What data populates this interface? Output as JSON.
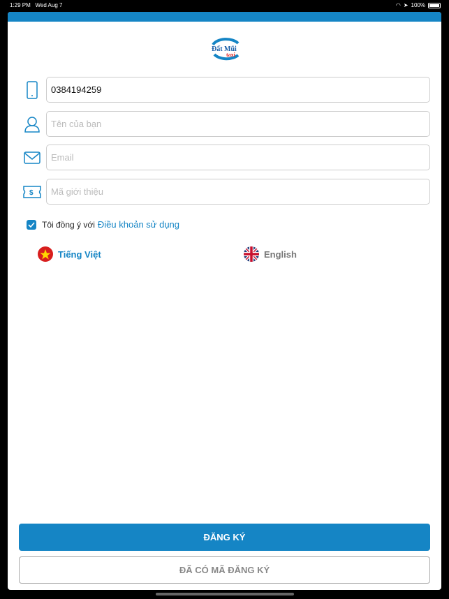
{
  "status_bar": {
    "time": "1:29 PM",
    "date": "Wed Aug 7",
    "battery": "100%"
  },
  "logo": {
    "text_main": "Đất Mũi",
    "text_sub": "taxi"
  },
  "form": {
    "phone": {
      "value": "0384194259",
      "icon": "phone-icon"
    },
    "name": {
      "placeholder": "Tên của bạn",
      "icon": "user-icon"
    },
    "email": {
      "placeholder": "Email",
      "icon": "mail-icon"
    },
    "referral": {
      "placeholder": "Mã giới thiệu",
      "icon": "ticket-icon"
    },
    "agree": {
      "checked": true,
      "text": "Tôi đồng ý với",
      "link": "Điều khoản sử dụng"
    }
  },
  "languages": [
    {
      "label": "Tiếng Việt",
      "selected": true,
      "color": "#1585c5"
    },
    {
      "label": "English",
      "selected": false,
      "color": "#777777"
    }
  ],
  "buttons": {
    "register": "ĐĂNG KÝ",
    "have_code": "ĐÃ CÓ MÃ ĐĂNG KÝ"
  },
  "colors": {
    "accent": "#1585c5"
  }
}
